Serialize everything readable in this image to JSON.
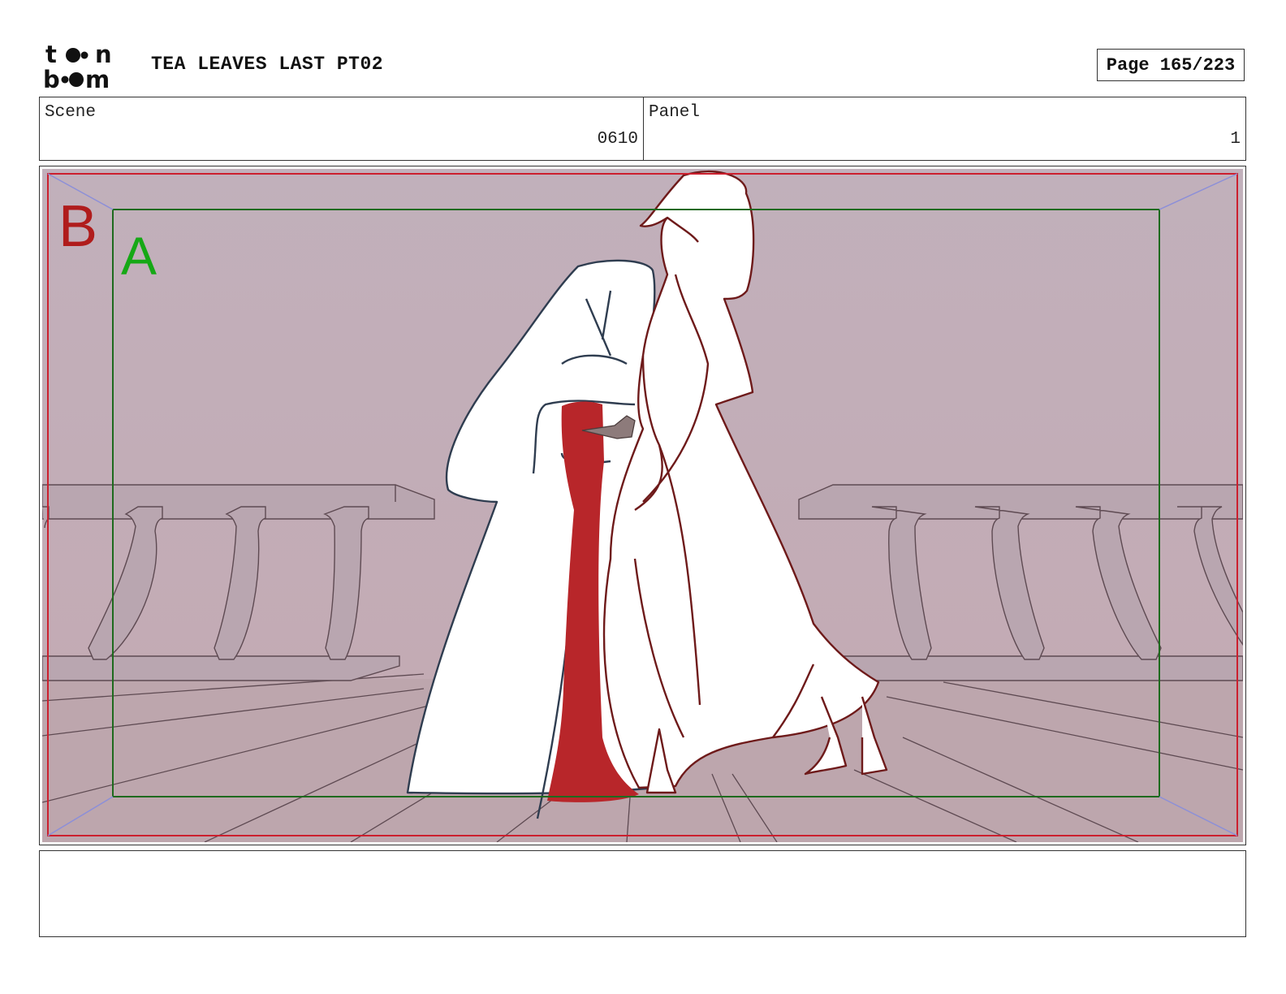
{
  "header": {
    "logo_text_top": "toon",
    "logo_text_bottom": "boom",
    "title": "TEA LEAVES LAST PT02",
    "page": "Page 165/223"
  },
  "scene": {
    "label": "Scene",
    "value": "0610"
  },
  "panel": {
    "label": "Panel",
    "value": "1"
  },
  "frame_markers": {
    "outer": "B",
    "inner": "A"
  },
  "colors": {
    "background": "#c2afb8",
    "floor": "#bfa7ae",
    "outer_frame": "#cc1f2e",
    "inner_frame": "#1e6a1e",
    "marker_b": "#b01c1c",
    "marker_a": "#16a816",
    "blood": "#b8262a",
    "figure_front_line": "#6e1a1a",
    "figure_back_line": "#2f3d50"
  },
  "caption": {
    "text": ""
  }
}
